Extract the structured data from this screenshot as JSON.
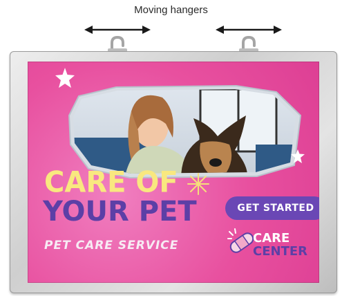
{
  "caption": "Moving hangers",
  "poster": {
    "headline_line1": "CARE OF",
    "headline_line2": "YOUR PET",
    "subtitle": "PET CARE SERVICE",
    "cta_label": "GET STARTED",
    "brand_line1": "CARE",
    "brand_line2": "CENTER"
  },
  "colors": {
    "poster_pink": "#e8509f",
    "headline_yellow": "#f9e87f",
    "brand_purple": "#5c3fa6",
    "frame_silver": "#cfcfcf"
  },
  "icons": [
    "double-arrow-icon",
    "hanger-hook-icon",
    "star-icon",
    "sparkle-icon",
    "bandage-icon"
  ]
}
